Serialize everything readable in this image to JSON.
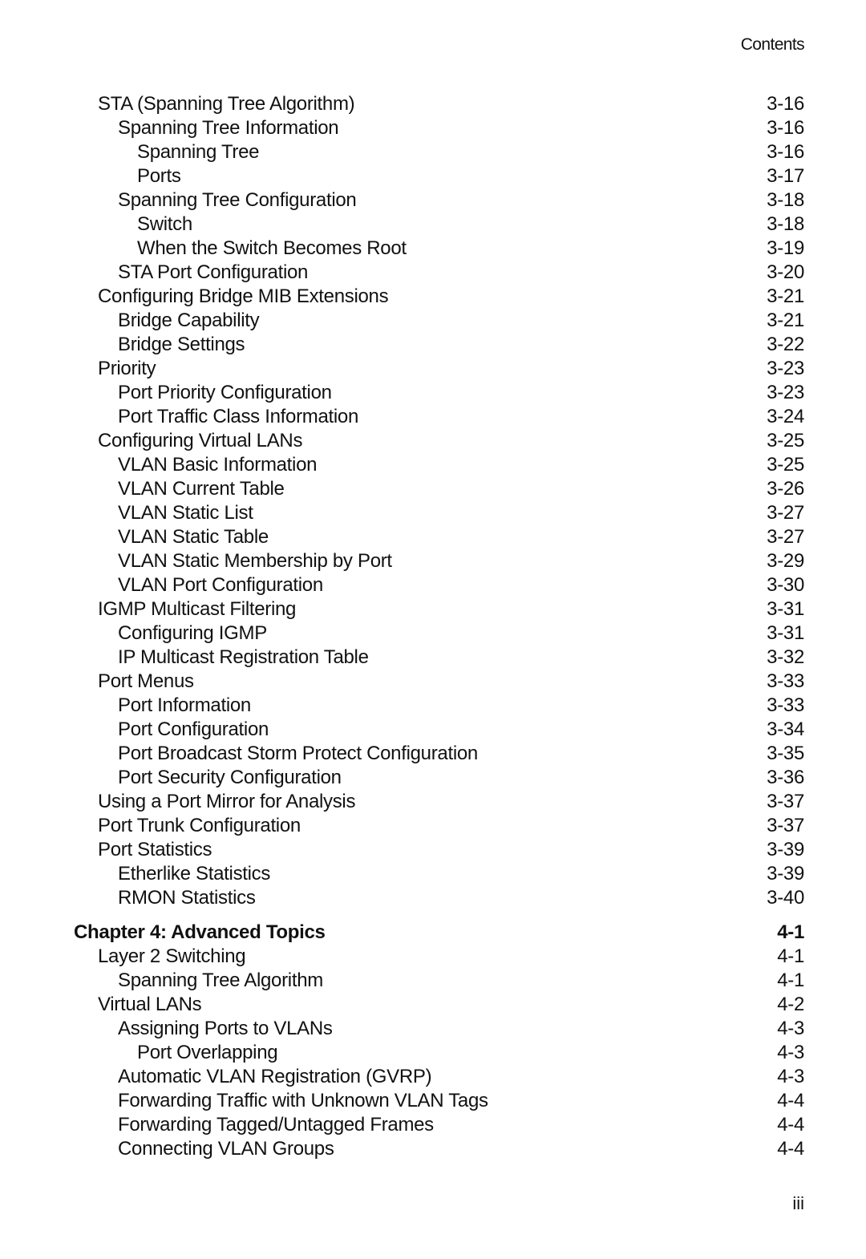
{
  "header": {
    "title": "Contents"
  },
  "footer": {
    "page_number": "iii"
  },
  "sections": [
    {
      "entries": [
        {
          "title": "STA (Spanning Tree Algorithm)",
          "page": "3-16",
          "level": 1
        },
        {
          "title": "Spanning Tree Information",
          "page": "3-16",
          "level": 2
        },
        {
          "title": "Spanning Tree",
          "page": "3-16",
          "level": 3
        },
        {
          "title": "Ports",
          "page": "3-17",
          "level": 3
        },
        {
          "title": "Spanning Tree Configuration",
          "page": "3-18",
          "level": 2
        },
        {
          "title": "Switch",
          "page": "3-18",
          "level": 3
        },
        {
          "title": "When the Switch Becomes Root",
          "page": "3-19",
          "level": 3
        },
        {
          "title": "STA Port Configuration",
          "page": "3-20",
          "level": 2
        },
        {
          "title": "Configuring Bridge MIB Extensions",
          "page": "3-21",
          "level": 1
        },
        {
          "title": "Bridge Capability",
          "page": "3-21",
          "level": 2
        },
        {
          "title": "Bridge Settings",
          "page": "3-22",
          "level": 2
        },
        {
          "title": "Priority",
          "page": "3-23",
          "level": 1
        },
        {
          "title": "Port Priority Configuration",
          "page": "3-23",
          "level": 2
        },
        {
          "title": "Port Traffic Class Information",
          "page": "3-24",
          "level": 2
        },
        {
          "title": "Configuring Virtual LANs",
          "page": "3-25",
          "level": 1
        },
        {
          "title": "VLAN Basic Information",
          "page": "3-25",
          "level": 2
        },
        {
          "title": "VLAN Current Table",
          "page": "3-26",
          "level": 2
        },
        {
          "title": "VLAN Static List",
          "page": "3-27",
          "level": 2
        },
        {
          "title": "VLAN Static Table",
          "page": "3-27",
          "level": 2
        },
        {
          "title": "VLAN Static Membership by Port",
          "page": "3-29",
          "level": 2
        },
        {
          "title": "VLAN Port Configuration",
          "page": "3-30",
          "level": 2
        },
        {
          "title": "IGMP Multicast Filtering",
          "page": "3-31",
          "level": 1
        },
        {
          "title": "Configuring IGMP",
          "page": "3-31",
          "level": 2
        },
        {
          "title": "IP Multicast Registration Table",
          "page": "3-32",
          "level": 2
        },
        {
          "title": "Port Menus",
          "page": "3-33",
          "level": 1
        },
        {
          "title": "Port Information",
          "page": "3-33",
          "level": 2
        },
        {
          "title": "Port Configuration",
          "page": "3-34",
          "level": 2
        },
        {
          "title": "Port Broadcast Storm Protect Configuration",
          "page": "3-35",
          "level": 2
        },
        {
          "title": "Port Security Configuration",
          "page": "3-36",
          "level": 2
        },
        {
          "title": "Using a Port Mirror for Analysis",
          "page": "3-37",
          "level": 1
        },
        {
          "title": "Port Trunk Configuration",
          "page": "3-37",
          "level": 1
        },
        {
          "title": "Port Statistics",
          "page": "3-39",
          "level": 1
        },
        {
          "title": "Etherlike Statistics",
          "page": "3-39",
          "level": 2
        },
        {
          "title": "RMON Statistics",
          "page": "3-40",
          "level": 2
        }
      ]
    },
    {
      "chapter": {
        "title": "Chapter 4: Advanced Topics",
        "page": "4-1"
      },
      "entries": [
        {
          "title": "Layer 2 Switching",
          "page": "4-1",
          "level": 1
        },
        {
          "title": "Spanning Tree Algorithm",
          "page": "4-1",
          "level": 2
        },
        {
          "title": "Virtual LANs",
          "page": "4-2",
          "level": 1
        },
        {
          "title": "Assigning Ports to VLANs",
          "page": "4-3",
          "level": 2
        },
        {
          "title": "Port Overlapping",
          "page": "4-3",
          "level": 3
        },
        {
          "title": "Automatic VLAN Registration (GVRP)",
          "page": "4-3",
          "level": 2
        },
        {
          "title": "Forwarding Traffic with Unknown VLAN Tags",
          "page": "4-4",
          "level": 2
        },
        {
          "title": "Forwarding Tagged/Untagged Frames",
          "page": "4-4",
          "level": 2
        },
        {
          "title": "Connecting VLAN Groups",
          "page": "4-4",
          "level": 2
        }
      ]
    }
  ]
}
